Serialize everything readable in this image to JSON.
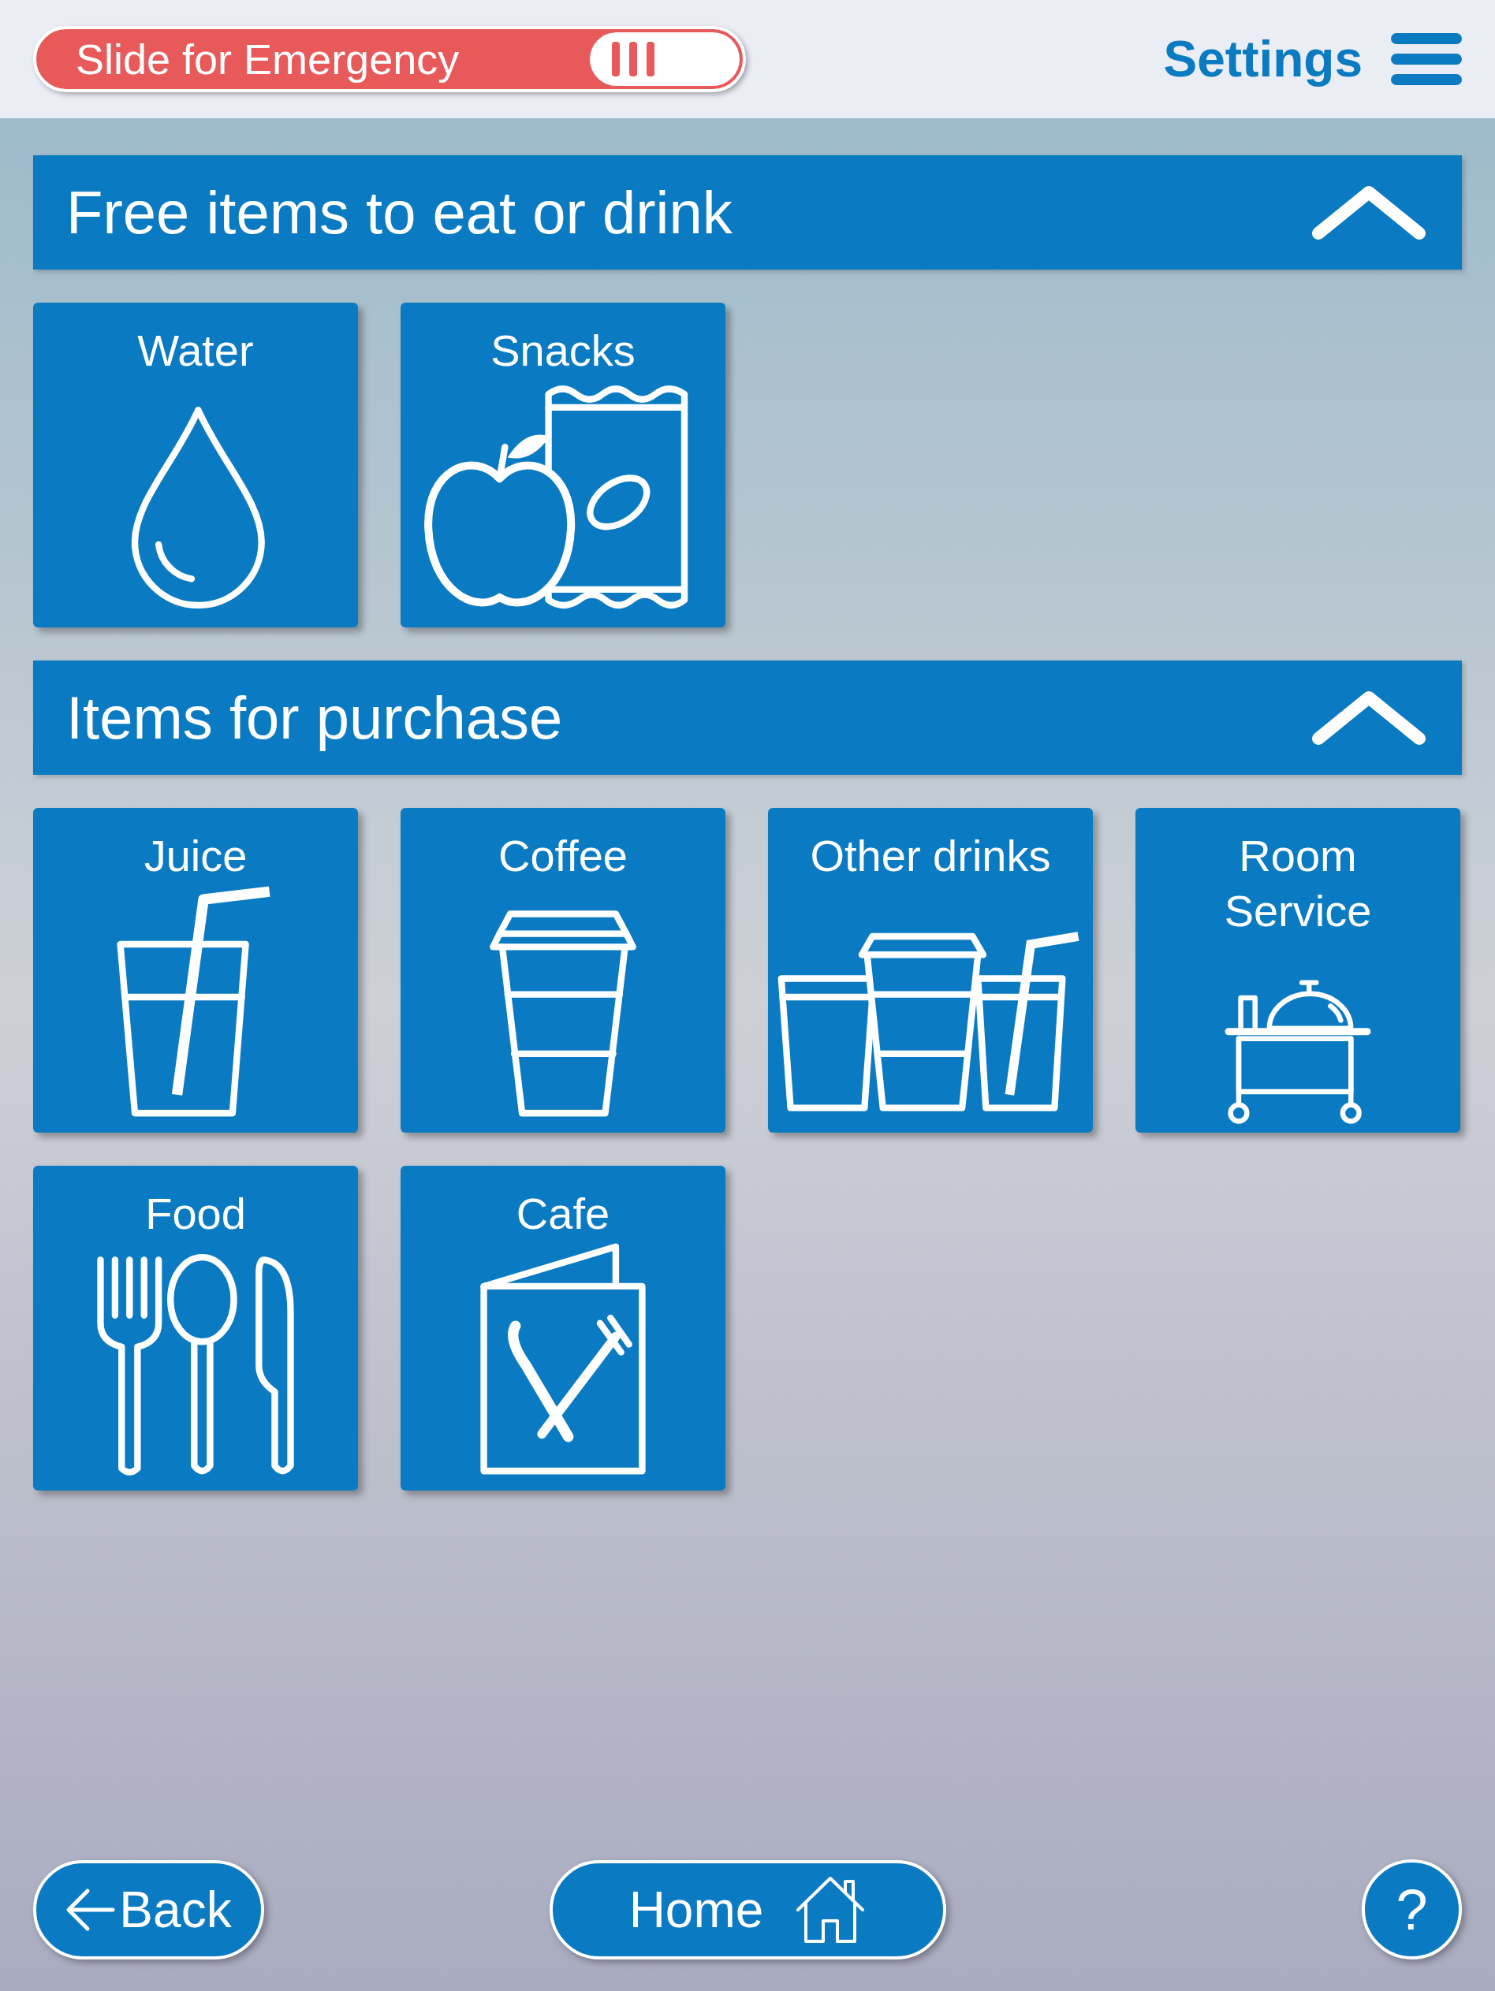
{
  "top_bar": {
    "emergency_slider": {
      "label": "Slide for Emergency",
      "on": false
    },
    "settings": {
      "label": "Settings"
    }
  },
  "sections": [
    {
      "title": "Free items to eat or drink",
      "expanded": true,
      "tiles": [
        {
          "label": "Water",
          "kind": "water"
        },
        {
          "label": "Snacks",
          "kind": "snacks"
        }
      ]
    },
    {
      "title": "Items for purchase",
      "expanded": true,
      "tiles": [
        {
          "label": "Juice",
          "kind": "juice"
        },
        {
          "label": "Coffee",
          "kind": "coffee"
        },
        {
          "label": "Other drinks",
          "kind": "drinks"
        },
        {
          "label": "Room Service",
          "kind": "room_service"
        },
        {
          "label": "Food",
          "kind": "food"
        },
        {
          "label": "Cafe",
          "kind": "cafe"
        }
      ]
    }
  ],
  "footer": {
    "back": {
      "label": "Back"
    },
    "home": {
      "label": "Home"
    },
    "help": {
      "label": "?"
    }
  }
}
